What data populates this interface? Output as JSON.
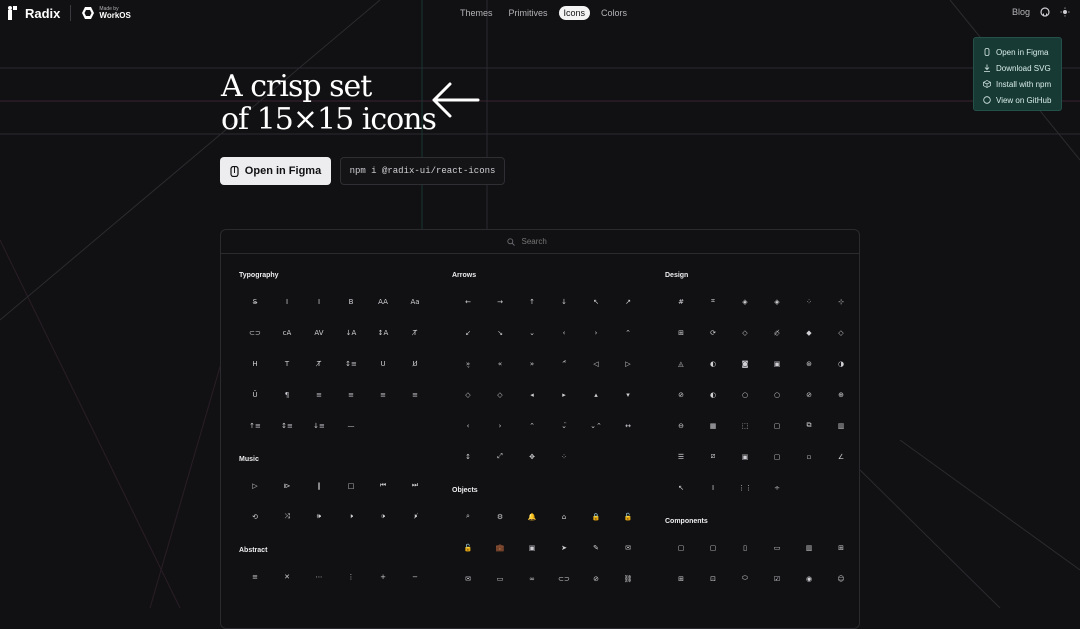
{
  "brand": {
    "name": "Radix",
    "made_by": "Made by",
    "partner": "WorkOS"
  },
  "nav": {
    "items": [
      "Themes",
      "Primitives",
      "Icons",
      "Colors"
    ],
    "active": "Icons"
  },
  "right_nav": {
    "blog": "Blog"
  },
  "dropdown": {
    "items": [
      "Open in Figma",
      "Download SVG",
      "Install with npm",
      "View on GitHub"
    ]
  },
  "hero": {
    "line1": "A crisp set",
    "line2": "of 15×15 icons",
    "figma_button": "Open in Figma",
    "npm_command": "npm i @radix-ui/react-icons"
  },
  "search": {
    "placeholder": "Search"
  },
  "categories": {
    "typography": {
      "title": "Typography",
      "glyphs": [
        "S̶",
        "I",
        "I",
        "B",
        "AA",
        "Aa",
        "⊂⊃",
        "cA",
        "AV",
        "↓A",
        "↕A",
        "T̸",
        "H",
        "T",
        "T̸",
        "↕≡",
        "U",
        "U̸",
        "Ū",
        "¶",
        "≡",
        "≡",
        "≡",
        "≡",
        "↑≡",
        "↕≡",
        "↓≡",
        "—"
      ]
    },
    "music": {
      "title": "Music",
      "glyphs": [
        "▷",
        "⧐",
        "‖",
        "□",
        "⏮",
        "⏭",
        "⟲",
        "⤨",
        "🕪",
        "🕨",
        "🕩",
        "🕨̸"
      ]
    },
    "abstract": {
      "title": "Abstract",
      "glyphs": [
        "≡",
        "✕",
        "⋯",
        "⋮",
        "+",
        "−"
      ]
    },
    "arrows": {
      "title": "Arrows",
      "glyphs": [
        "←",
        "→",
        "↑",
        "↓",
        "↖",
        "↗",
        "↙",
        "↘",
        "⌄",
        "‹",
        "›",
        "⌃",
        "»̬",
        "«",
        "»",
        "⌃̂",
        "◁",
        "▷",
        "◇",
        "◇",
        "◂",
        "▸",
        "▴",
        "▾",
        "‹",
        "›",
        "⌃",
        "⌄̈",
        "⌄⌃",
        "↔",
        "↕",
        "⤢",
        "✥",
        "⁘"
      ]
    },
    "objects": {
      "title": "Objects",
      "glyphs": [
        "⌕",
        "⚙",
        "🔔",
        "⌂",
        "🔒",
        "🔓",
        "🔓",
        "💼",
        "▣",
        "➤",
        "✎",
        "✉",
        "✉",
        "▭",
        "∞",
        "⊂⊃",
        "⊘",
        "⛓"
      ]
    },
    "design": {
      "title": "Design",
      "glyphs": [
        "#",
        "⌗",
        "◈",
        "◈",
        "⁘",
        "⊹",
        "⊞",
        "⟳",
        "◇",
        "◇̸",
        "◆",
        "◇",
        "◬",
        "◐",
        "◙",
        "▣",
        "⊛",
        "◑",
        "⊘",
        "◐",
        "○",
        "○",
        "⊘",
        "⊕",
        "⊖",
        "▦",
        "⬚",
        "▢",
        "⧉",
        "▥",
        "☰",
        "⧄",
        "▣",
        "▢",
        "▫",
        "∠",
        "↖",
        "Ⅰ",
        "⋮⋮",
        "÷"
      ]
    },
    "components": {
      "title": "Components",
      "glyphs": [
        "▢",
        "▢",
        "▯",
        "▭",
        "▥",
        "⊞",
        "⊞",
        "⊡",
        "⬭",
        "☑",
        "◉",
        "☺"
      ]
    }
  }
}
